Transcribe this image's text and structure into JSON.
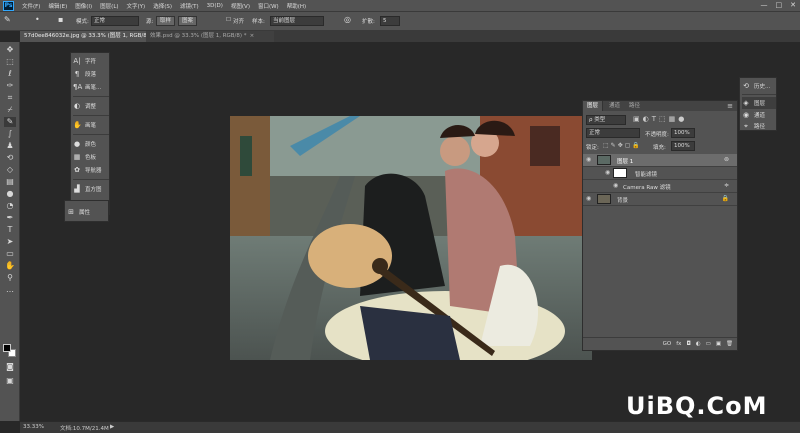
{
  "app": {
    "logo": "Ps"
  },
  "menu": [
    "文件(F)",
    "编辑(E)",
    "图像(I)",
    "图层(L)",
    "文字(Y)",
    "选择(S)",
    "滤镜(T)",
    "3D(D)",
    "视图(V)",
    "窗口(W)",
    "帮助(H)"
  ],
  "window_controls": [
    "—",
    "□",
    "✕"
  ],
  "options": {
    "mode_label": "模式:",
    "mode_value": "正常",
    "opacity_label": "源:",
    "source_btn": "取样",
    "pattern_btn": "图案",
    "aligned_label": "对齐",
    "sample_label": "样本:",
    "sample_value": "当前图层",
    "diffusion_label": "扩散:",
    "diffusion_value": "5"
  },
  "tabs": [
    {
      "label": "57d0ee846032e.jpg @ 33.3% (图层 1, RGB/8) *",
      "close": "×"
    },
    {
      "label": "效果.psd @ 33.3% (图层 1, RGB/8) *",
      "close": "×"
    }
  ],
  "left_panel": [
    {
      "icon": "A|",
      "label": "字符"
    },
    {
      "icon": "¶",
      "label": "段落"
    },
    {
      "icon": "¶A",
      "label": "画笔..."
    },
    {
      "icon": "◐",
      "label": "调整"
    },
    {
      "icon": "✋",
      "label": "画笔"
    },
    {
      "icon": "●",
      "label": "颜色"
    },
    {
      "icon": "▦",
      "label": "色板"
    },
    {
      "icon": "✿",
      "label": "导航器"
    },
    {
      "icon": "▟",
      "label": "直方图"
    }
  ],
  "props_panel": {
    "icon": "⊞",
    "label": "属性"
  },
  "layers_panel": {
    "tabs": [
      "图层",
      "通道",
      "路径"
    ],
    "filter_label": "ρ 类型",
    "blend_mode": "正常",
    "opacity_label": "不透明度:",
    "opacity_value": "100%",
    "lock_label": "锁定:",
    "fill_label": "填充:",
    "fill_value": "100%",
    "layers": [
      {
        "name": "图层 1"
      },
      {
        "name": "智能滤镜"
      },
      {
        "name": "Camera Raw 滤镜"
      },
      {
        "name": "背景"
      }
    ],
    "footer_icons": [
      "GO",
      "fx",
      "◘",
      "◐",
      "▭",
      "▣",
      "🗑"
    ]
  },
  "right_collapsed": [
    {
      "icon": "⟲",
      "label": "历史..."
    },
    {
      "icon": "◈",
      "label": "图层"
    },
    {
      "icon": "◉",
      "label": "通道"
    },
    {
      "icon": "⌖",
      "label": "路径"
    }
  ],
  "status": {
    "zoom": "33.33%",
    "doc": "文档:10.7M/21.4M",
    "arrow": "▶"
  },
  "watermark": "UiBQ.CoM"
}
